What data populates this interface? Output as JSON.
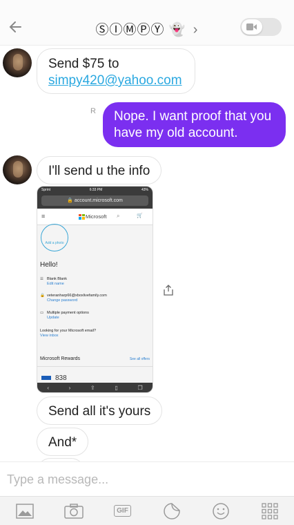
{
  "header": {
    "title": "ⓈⒾⓂⓅⓎ 👻",
    "chevron": "›"
  },
  "messages": [
    {
      "id": "m1",
      "from": "them",
      "text": "Send $75 to",
      "link": "simpy420@yahoo.com"
    },
    {
      "id": "m2",
      "from": "me",
      "line1": "Nope. I want proof that you",
      "line2": "have my old account.",
      "read_marker": "R"
    },
    {
      "id": "m3",
      "from": "them",
      "text": "I'll send u the info"
    },
    {
      "id": "m5",
      "from": "them",
      "text": "Send all it's yours"
    },
    {
      "id": "m6",
      "from": "them",
      "text": "And*"
    }
  ],
  "screenshot": {
    "carrier": "Sprint",
    "time": "6:33 PM",
    "battery": "43%",
    "url": "🔒 account.microsoft.com",
    "brand": "Microsoft",
    "add_photo": "Add a photo",
    "greeting": "Hello!",
    "name": "Blank Blank",
    "edit_name": "Edit name",
    "email": "veteranharp66@xboxlivefamily.com",
    "change_password": "Change password",
    "payment": "Multiple payment options",
    "update": "Update",
    "looking": "Looking for your Microsoft email?",
    "view_inbox": "View inbox",
    "rewards": "Microsoft Rewards",
    "see_all": "See all offers",
    "points": "838",
    "colors": {
      "red": "#f25022",
      "green": "#7fba00",
      "blue": "#00a4ef",
      "yellow": "#ffb900"
    }
  },
  "composer": {
    "placeholder": "Type a message..."
  },
  "toolbar": {
    "gif_label": "GIF"
  },
  "colors": {
    "outgoing": "#7b2ff0",
    "link": "#2aa8e0"
  }
}
